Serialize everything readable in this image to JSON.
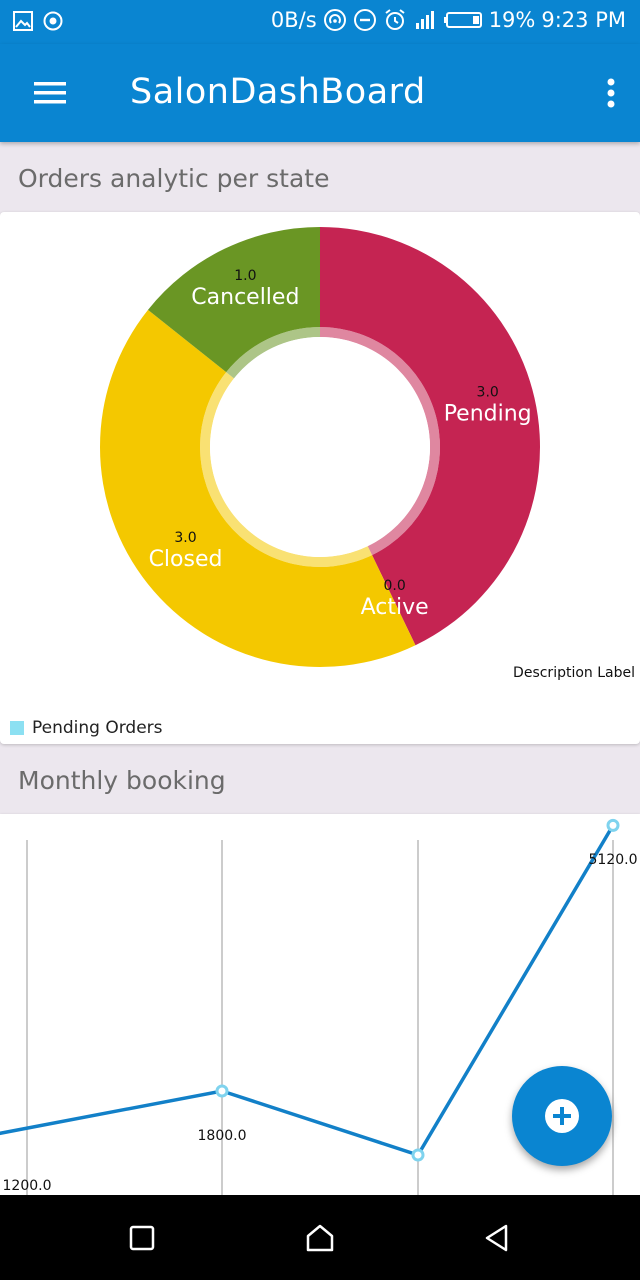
{
  "status_bar": {
    "net_speed": "0B/s",
    "battery": "19%",
    "time": "9:23 PM",
    "icons": [
      "gallery-icon",
      "record-icon",
      "hotspot-icon",
      "dnd-icon",
      "alarm-icon",
      "signal-icon",
      "battery-icon"
    ]
  },
  "app_bar": {
    "title": "SalonDashBoard",
    "color": "#0A85D1"
  },
  "section1": {
    "title": "Orders analytic per state"
  },
  "section2": {
    "title": "Monthly booking"
  },
  "chart_data": [
    {
      "type": "pie",
      "donut": true,
      "slices": [
        {
          "label": "Pending",
          "value": 3.0,
          "value_label": "3.0",
          "color": "#C52452"
        },
        {
          "label": "Active",
          "value": 0.0,
          "value_label": "0.0",
          "color": "#F4C800"
        },
        {
          "label": "Closed",
          "value": 3.0,
          "value_label": "3.0",
          "color": "#F4C800"
        },
        {
          "label": "Cancelled",
          "value": 1.0,
          "value_label": "1.0",
          "color": "#6A9624"
        }
      ],
      "description": "Description Label",
      "legend": [
        {
          "label": "Pending  Orders",
          "color": "#8CE0F2"
        }
      ],
      "legend_position": "bottom-left"
    },
    {
      "type": "line",
      "series": [
        {
          "color": "#1280C8",
          "points": [
            {
              "value": 1200.0,
              "label": "1200.0"
            },
            {
              "value": 1800.0,
              "label": "1800.0"
            },
            {
              "value": 1000.0,
              "label": ""
            },
            {
              "value": 5120.0,
              "label": "5120.0"
            }
          ]
        }
      ],
      "grid": "vertical"
    }
  ],
  "fab": {
    "icon": "add-icon"
  },
  "nav_bar": {
    "icons": [
      "recents-icon",
      "home-icon",
      "back-icon"
    ]
  }
}
